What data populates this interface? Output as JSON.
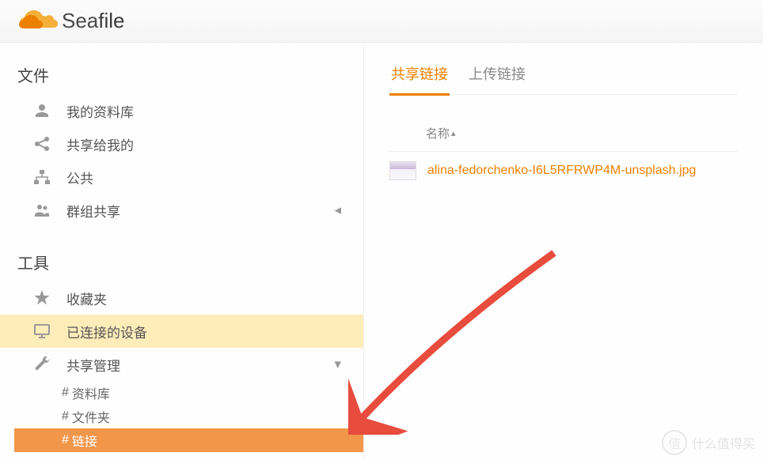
{
  "brand": {
    "name_light": "Sea",
    "name_bold": "file"
  },
  "sidebar": {
    "section_files": "文件",
    "section_tools": "工具",
    "items": {
      "my_library": "我的资料库",
      "shared_with_me": "共享给我的",
      "public": "公共",
      "group_share": "群组共享",
      "favorites": "收藏夹",
      "connected_devices": "已连接的设备",
      "share_admin": "共享管理"
    },
    "sub": {
      "libraries": "资料库",
      "folders": "文件夹",
      "links": "链接"
    }
  },
  "tabs": {
    "share_link": "共享链接",
    "upload_link": "上传链接"
  },
  "table": {
    "col_name": "名称",
    "rows": [
      {
        "filename": "alina-fedorchenko-I6L5RFRWP4M-unsplash.jpg"
      }
    ]
  },
  "watermark": "什么值得买"
}
